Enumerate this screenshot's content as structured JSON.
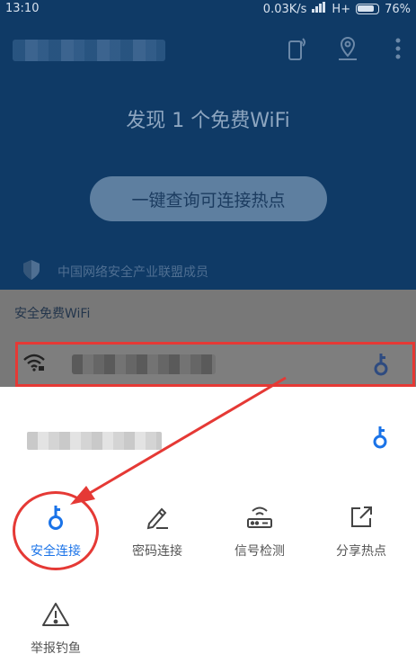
{
  "status_bar": {
    "time": "13:10",
    "speed": "0.03K/s",
    "network": "H+",
    "battery": "76%"
  },
  "header": {
    "found_text": "发现 1 个免费WiFi",
    "query_button": "一键查询可连接热点",
    "member_text": "中国网络安全产业联盟成员"
  },
  "section": {
    "title": "安全免费WiFi"
  },
  "sheet": {
    "actions": [
      {
        "label": "安全连接",
        "icon": "key-icon"
      },
      {
        "label": "密码连接",
        "icon": "pencil-icon"
      },
      {
        "label": "信号检测",
        "icon": "router-icon"
      },
      {
        "label": "分享热点",
        "icon": "share-icon"
      },
      {
        "label": "举报钓鱼",
        "icon": "warning-icon"
      }
    ]
  },
  "colors": {
    "accent": "#1a73e8",
    "highlight": "#e53935",
    "dim_bg": "#0f3a66"
  }
}
